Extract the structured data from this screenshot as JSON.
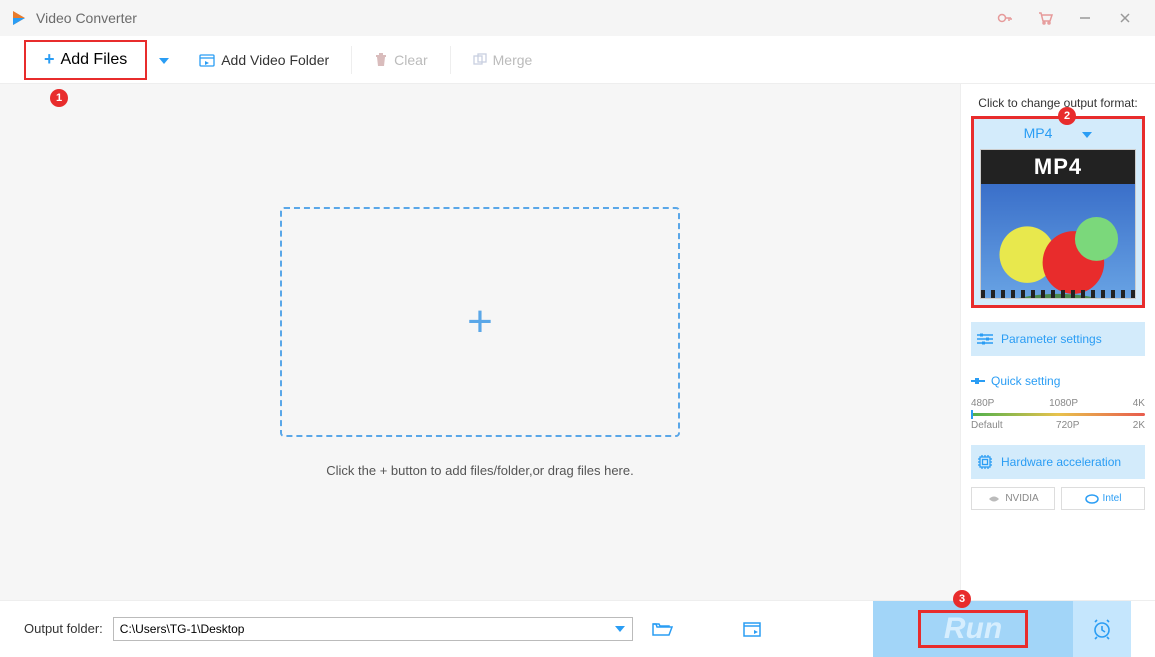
{
  "titlebar": {
    "title": "Video Converter"
  },
  "toolbar": {
    "add_files": "Add Files",
    "add_folder": "Add Video Folder",
    "clear": "Clear",
    "merge": "Merge"
  },
  "dropzone": {
    "hint": "Click the + button to add files/folder,or drag files here."
  },
  "rightpanel": {
    "change_format_label": "Click to change output format:",
    "format": "MP4",
    "thumb_label": "MP4",
    "parameter_settings": "Parameter settings",
    "quick_setting": "Quick setting",
    "scale_top": [
      "480P",
      "1080P",
      "4K"
    ],
    "scale_bottom": [
      "Default",
      "720P",
      "2K"
    ],
    "hardware_accel": "Hardware acceleration",
    "nvidia": "NVIDIA",
    "intel": "Intel"
  },
  "bottombar": {
    "output_folder_label": "Output folder:",
    "output_folder_value": "C:\\Users\\TG-1\\Desktop",
    "run": "Run"
  },
  "annotations": {
    "b1": "1",
    "b2": "2",
    "b3": "3"
  }
}
